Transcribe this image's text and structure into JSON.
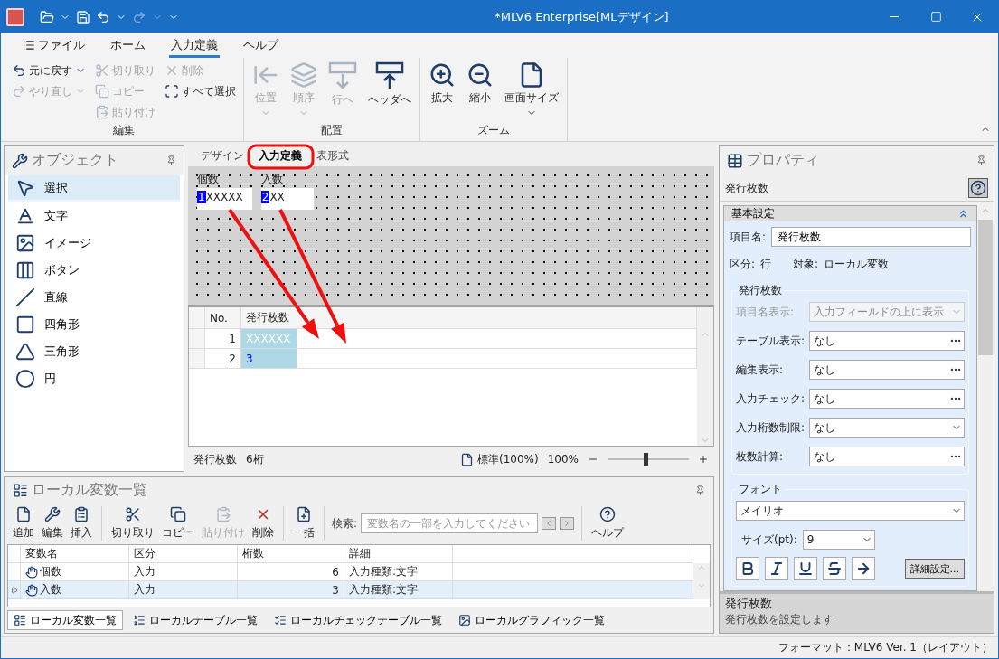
{
  "window": {
    "title": "*MLV6 Enterprise[MLデザイン]"
  },
  "menu_tabs": [
    {
      "label": "ファイル",
      "selected": false
    },
    {
      "label": "ホーム",
      "selected": false
    },
    {
      "label": "入力定義",
      "selected": true
    },
    {
      "label": "ヘルプ",
      "selected": false
    }
  ],
  "ribbon": [
    {
      "label": "編集",
      "kind": "small",
      "columns": [
        {
          "items": [
            {
              "label": "元に戻す",
              "disabled": false,
              "dropdown": true
            },
            {
              "label": "やり直し",
              "disabled": true,
              "dropdown": true
            }
          ]
        },
        {
          "items": [
            {
              "label": "切り取り",
              "disabled": true,
              "dropdown": false
            },
            {
              "label": "コピー",
              "disabled": true,
              "dropdown": false
            },
            {
              "label": "貼り付け",
              "disabled": true,
              "dropdown": false
            }
          ]
        },
        {
          "items": [
            {
              "label": "削除",
              "disabled": true,
              "dropdown": false
            },
            {
              "label": "すべて選択",
              "disabled": false,
              "dropdown": false
            }
          ]
        }
      ]
    },
    {
      "label": "配置",
      "kind": "large",
      "items": [
        {
          "label": "位置",
          "disabled": true,
          "dropdown": true
        },
        {
          "label": "順序",
          "disabled": true,
          "dropdown": true
        },
        {
          "label": "行へ",
          "disabled": true,
          "dropdown": false
        },
        {
          "label": "ヘッダへ",
          "disabled": false,
          "dropdown": false
        }
      ]
    },
    {
      "label": "ズーム",
      "kind": "large",
      "items": [
        {
          "label": "拡大",
          "disabled": false,
          "dropdown": false
        },
        {
          "label": "縮小",
          "disabled": false,
          "dropdown": false
        },
        {
          "label": "画面サイズ",
          "disabled": false,
          "dropdown": true
        }
      ]
    }
  ],
  "object_panel": {
    "title": "オブジェクト",
    "items": [
      {
        "label": "選択",
        "selected": true
      },
      {
        "label": "文字",
        "selected": false
      },
      {
        "label": "イメージ",
        "selected": false
      },
      {
        "label": "ボタン",
        "selected": false
      },
      {
        "label": "直線",
        "selected": false
      },
      {
        "label": "四角形",
        "selected": false
      },
      {
        "label": "三角形",
        "selected": false
      },
      {
        "label": "円",
        "selected": false
      }
    ]
  },
  "designer": {
    "tabs": [
      {
        "label": "デザイン",
        "selected": false
      },
      {
        "label": "入力定義",
        "selected": true
      },
      {
        "label": "表形式",
        "selected": false
      }
    ],
    "canvas_fields": [
      {
        "label": "個数",
        "number": "1",
        "value": "XXXXX"
      },
      {
        "label": "入数",
        "number": "2",
        "value": "XX"
      }
    ],
    "grid": {
      "columns": [
        "No.",
        "発行枚数"
      ],
      "rows": [
        {
          "no": "1",
          "value": "XXXXXX",
          "kind": "sample"
        },
        {
          "no": "2",
          "value": "3",
          "kind": "entry"
        }
      ]
    },
    "status": {
      "field": "発行枚数",
      "digits": "6桁",
      "zoom_mode": "標準(100%)",
      "zoom": "100%",
      "level": 0.47
    }
  },
  "properties": {
    "title": "プロパティ",
    "subject": "発行枚数",
    "section": {
      "title": "基本設定",
      "expanded": true
    },
    "name_label": "項目名:",
    "name_value": "発行枚数",
    "category_label": "区分:",
    "category": "行",
    "target_label": "対象:",
    "target": "ローカル変数",
    "group": {
      "title": "発行枚数",
      "rows": [
        {
          "label": "項目名表示:",
          "value": "入力フィールドの上に表示",
          "kind": "dropdown",
          "disabled": true
        },
        {
          "label": "テーブル表示:",
          "value": "なし",
          "kind": "dialog",
          "disabled": false
        },
        {
          "label": "編集表示:",
          "value": "なし",
          "kind": "dialog",
          "disabled": false
        },
        {
          "label": "入力チェック:",
          "value": "なし",
          "kind": "dialog",
          "disabled": false
        },
        {
          "label": "入力桁数制限:",
          "value": "なし",
          "kind": "dropdown",
          "disabled": false
        },
        {
          "label": "枚数計算:",
          "value": "なし",
          "kind": "dialog",
          "disabled": false
        }
      ]
    },
    "font": {
      "title": "フォント",
      "face": "メイリオ",
      "size_label": "サイズ(pt):",
      "size": "9",
      "details_button": "詳細設定..."
    },
    "description": {
      "title": "発行枚数",
      "text": "発行枚数を設定します"
    }
  },
  "variables_panel": {
    "title": "ローカル変数一覧",
    "toolbar_groups": [
      [
        {
          "label": "追加",
          "disabled": false
        },
        {
          "label": "編集",
          "disabled": false
        },
        {
          "label": "挿入",
          "disabled": false
        }
      ],
      [
        {
          "label": "切り取り",
          "disabled": false
        },
        {
          "label": "コピー",
          "disabled": false
        },
        {
          "label": "貼り付け",
          "disabled": true
        },
        {
          "label": "削除",
          "disabled": false
        }
      ],
      [
        {
          "label": "一括",
          "disabled": false
        }
      ]
    ],
    "search_label": "検索:",
    "search": {
      "placeholder": "変数名の一部を入力してください"
    },
    "help_button": "ヘルプ",
    "columns": [
      "変数名",
      "区分",
      "桁数",
      "詳細"
    ],
    "rows": [
      {
        "name": "個数",
        "category": "入力",
        "digits": "6",
        "detail": "入力種類:文字",
        "selected": false
      },
      {
        "name": "入数",
        "category": "入力",
        "digits": "3",
        "detail": "入力種類:文字",
        "selected": true
      }
    ],
    "tabs": [
      {
        "label": "ローカル変数一覧",
        "selected": true
      },
      {
        "label": "ローカルテーブル一覧",
        "selected": false
      },
      {
        "label": "ローカルチェックテーブル一覧",
        "selected": false
      },
      {
        "label": "ローカルグラフィック一覧",
        "selected": false
      }
    ]
  },
  "status_bar": {
    "text": "フォーマット：MLV6 Ver. 1（レイアウト）"
  }
}
